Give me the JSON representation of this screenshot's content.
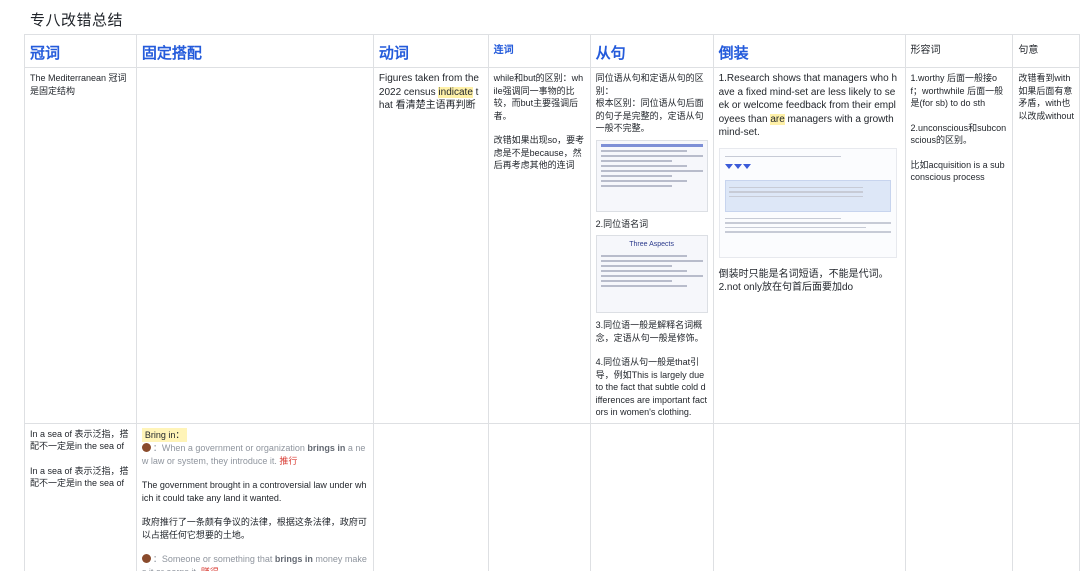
{
  "page": {
    "title": "专八改错总结"
  },
  "columns": {
    "c1": "冠词",
    "c2": "固定搭配",
    "c3": "动词",
    "c4": "连词",
    "c5": "从句",
    "c6": "倒装",
    "c7": "形容词",
    "c8": "句意"
  },
  "row1": {
    "c1": "The Mediterranean 冠词是固定结构",
    "c3": {
      "pre": "Figures taken from the 2022 census ",
      "hl": "indicate",
      "post": " that 看清楚主语再判断"
    },
    "c4": {
      "p1": "while和but的区别：while强调同一事物的比较，而but主要强调后者。",
      "p2": "改错如果出现so，要考虑是不是because，然后再考虑其他的连词"
    },
    "c5": {
      "p1": "同位语从句和定语从句的区别：",
      "p2": "根本区别：同位语从句后面的句子是完整的，定语从句一般不完整。",
      "thumb2_title": "Three Aspects",
      "p3": "2.同位语名词",
      "p4": "3.同位语一般是解释名词概念，定语从句一般是修饰。",
      "p5": "4.同位语从句一般是that引导，例如This is largely due to the fact that subtle cold differences are important factors in women's clothing."
    },
    "c6": {
      "p1_pre": "1.Research shows that managers who have a fixed mind-set are less likely to seek or welcome feedback from their employees than ",
      "p1_hl": "are",
      "p1_post": " managers with a growth mind-set.",
      "p2": "倒装时只能是名词短语，不能是代词。",
      "p3": "2.not only放在句首后面要加do"
    },
    "c7": {
      "p1": "1.worthy 后面一般接of；worthwhile 后面一般是(for sb) to do sth",
      "p2": "2.unconscious和subconscious的区别。",
      "p3": "比如acquisition is a subconscious process"
    },
    "c8": {
      "l1": "改错看到with",
      "l2": "如果后面有意",
      "l3": "矛盾，with也",
      "l4": "以改成without"
    }
  },
  "row2": {
    "c1": {
      "p1": "In a sea of 表示泛指，搭配不一定是in the sea of",
      "p2": "In a sea of 表示泛指，搭配不一定是in the sea of"
    },
    "c2": {
      "tag": "Bring in：",
      "d1_pre": "：When a government or organization ",
      "d1_bold": "brings in",
      "d1_post": " a new law or system, they introduce it. ",
      "d1_cn": "推行",
      "ex1": "The government brought in a controversial law under which it could take any land it wanted.",
      "ex1_cn": "政府推行了一条颇有争议的法律，根据这条法律，政府可以占据任何它想要的土地。",
      "d2_pre": "：Someone or something that ",
      "d2_bold": "brings in",
      "d2_post": " money makes it or earns it. ",
      "d2_cn": "赚得"
    }
  },
  "colors": {
    "header_blue": "#245bdb",
    "highlight": "#fff1a8",
    "red": "#d83931",
    "border": "#dee0e3"
  },
  "icons": {
    "bullet": "brown-circle-icon"
  }
}
